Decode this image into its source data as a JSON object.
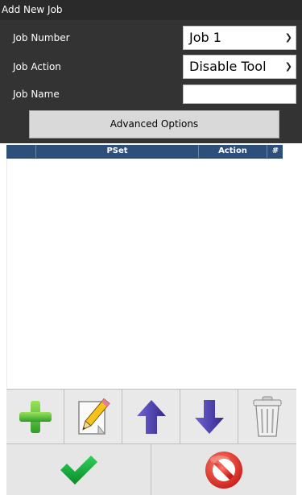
{
  "dialog": {
    "title": "Add New Job"
  },
  "form": {
    "job_number_label": "Job Number",
    "job_number_value": "Job 1",
    "job_action_label": "Job Action",
    "job_action_value": "Disable Tool",
    "job_name_label": "Job Name",
    "job_name_value": "",
    "advanced_button": "Advanced Options"
  },
  "grid": {
    "columns": [
      "",
      "PSet",
      "Action",
      "#"
    ],
    "rows": []
  },
  "toolbar": {
    "icons": [
      "add-icon",
      "edit-pencil-icon",
      "move-up-arrow-icon",
      "move-down-arrow-icon",
      "trash-icon"
    ]
  },
  "footer": {
    "icons": [
      "confirm-checkmark-icon",
      "cancel-no-icon"
    ]
  },
  "colors": {
    "header_bg": "#333333",
    "grid_header_bg": "#2d4f7a",
    "add_green": "#4fbe3a",
    "arrow_purple": "#4a3fa3",
    "check_green": "#16a838",
    "cancel_red": "#e0302a"
  }
}
